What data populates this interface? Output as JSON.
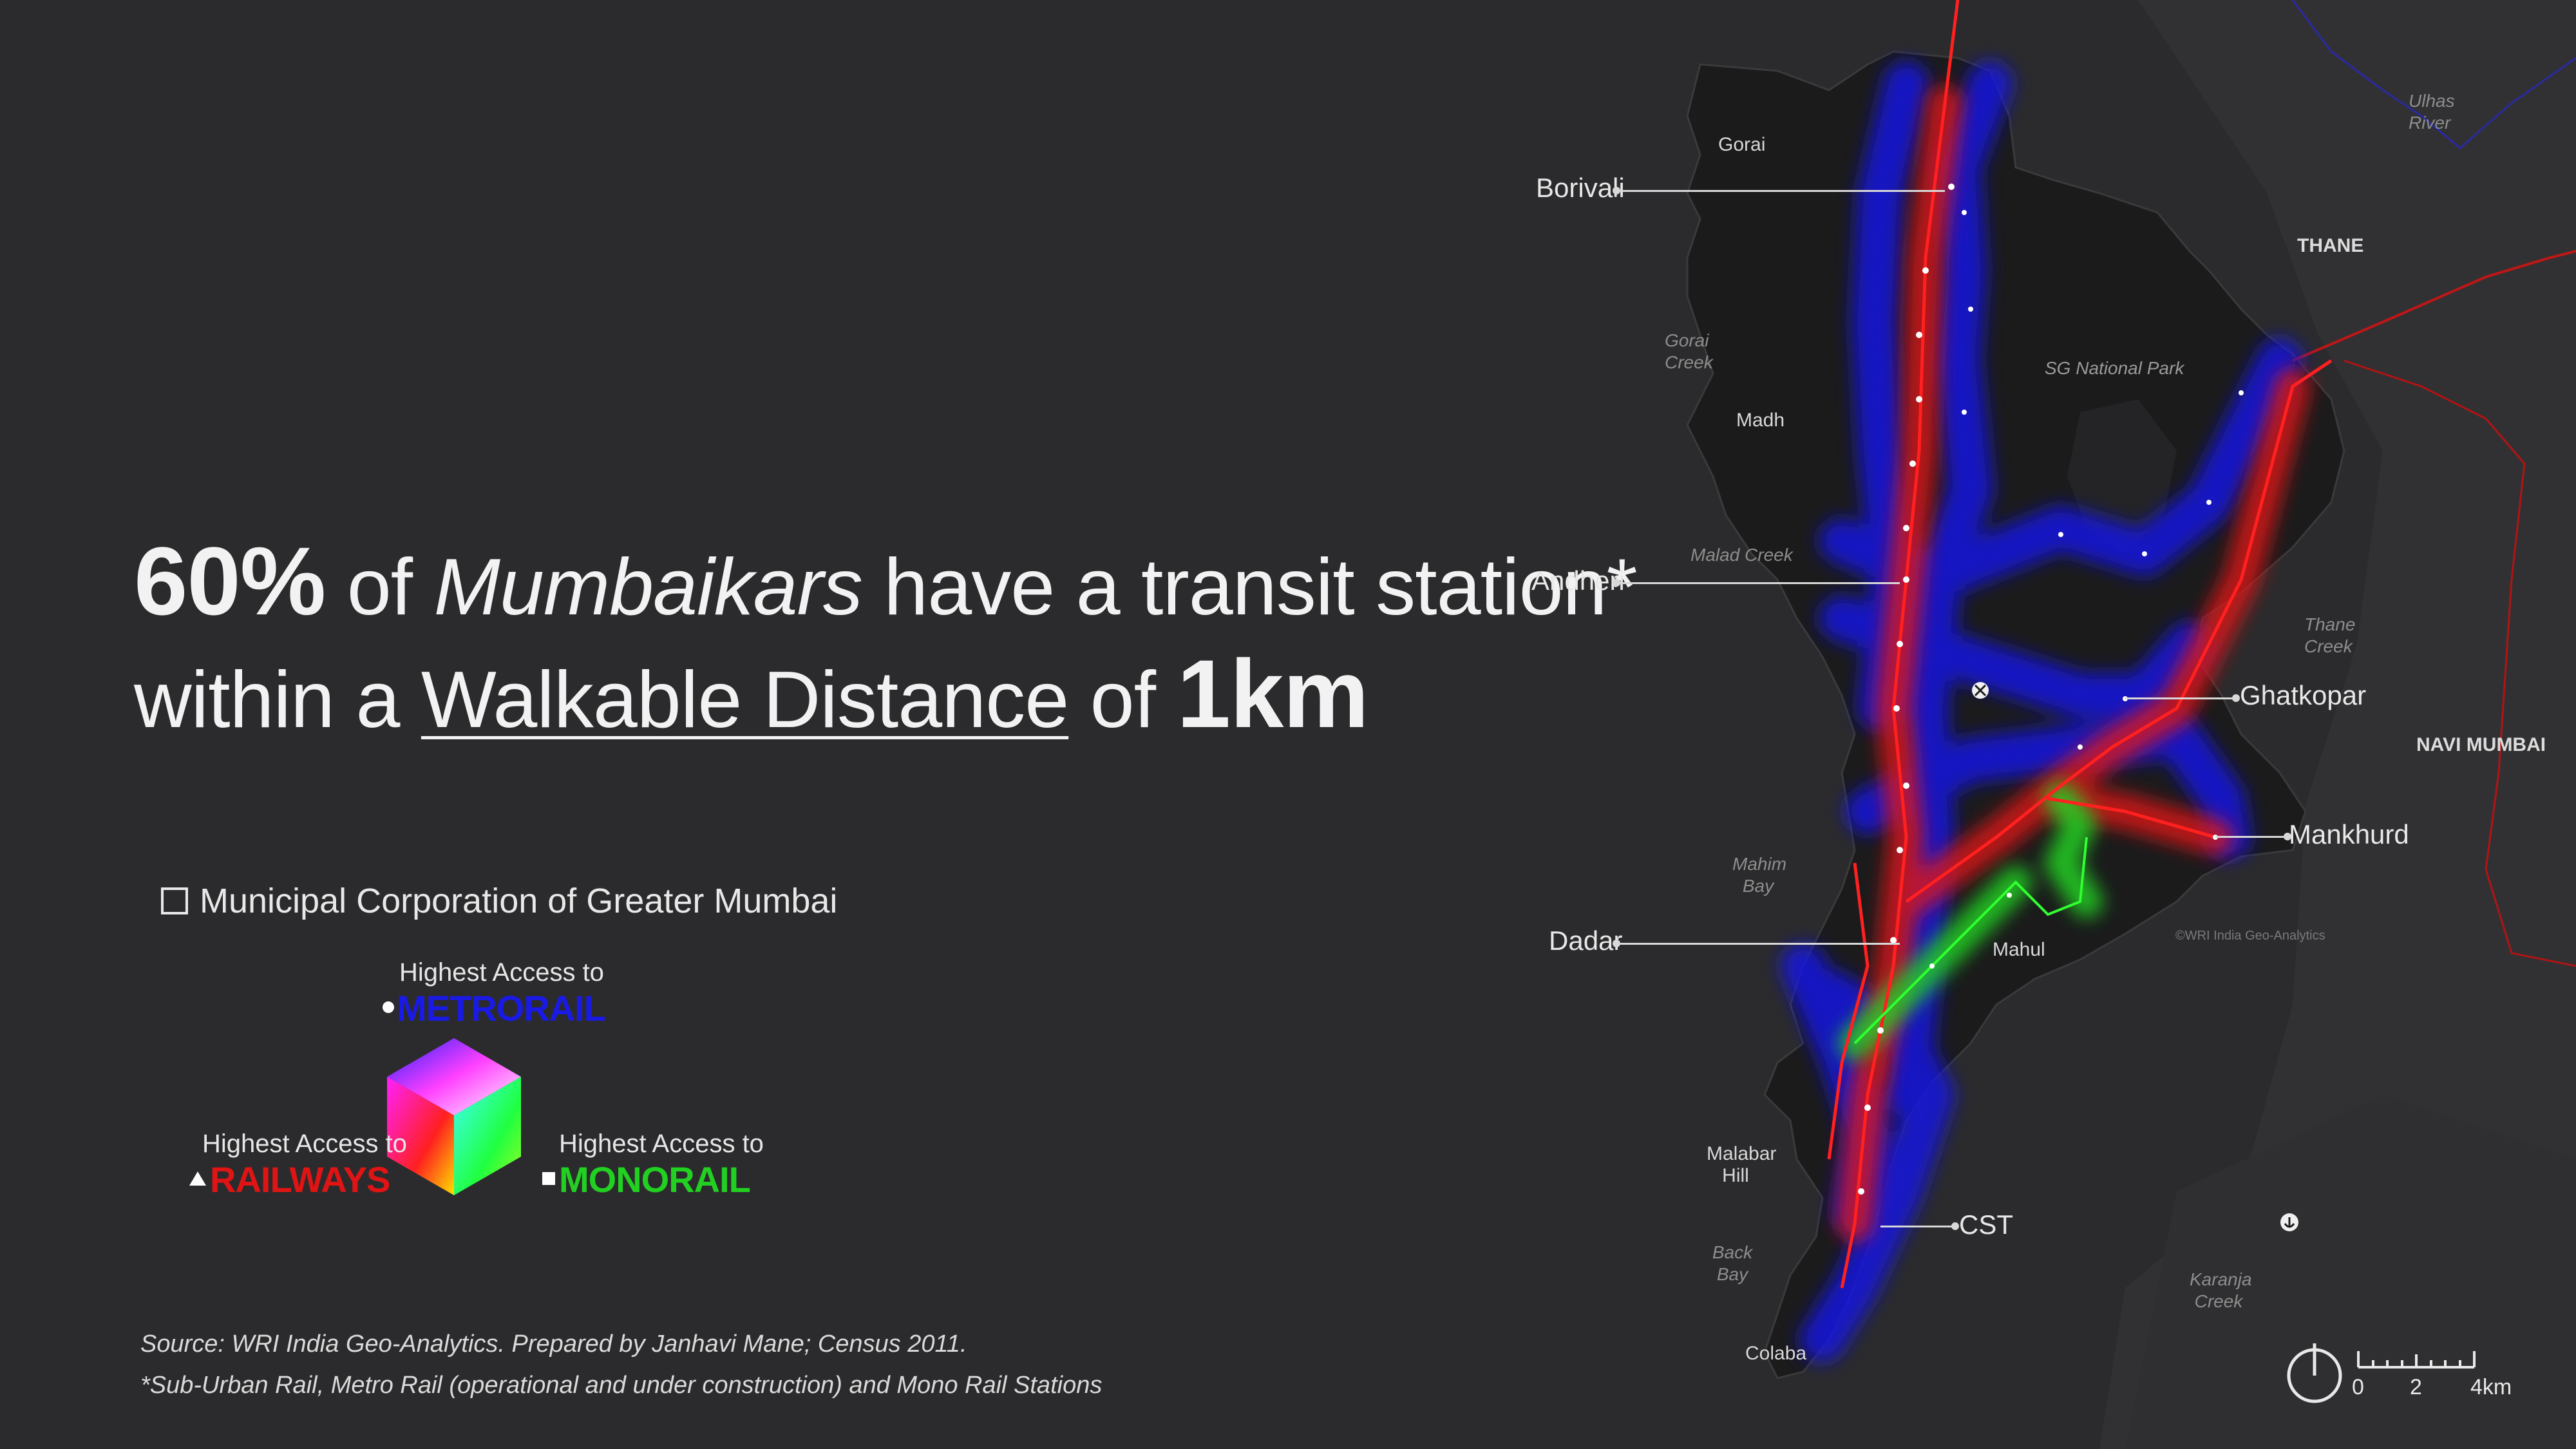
{
  "headline": {
    "line1": {
      "stat": "60%",
      "of": "of",
      "subject": "Mumbaikars",
      "rest": "have a transit station*"
    },
    "line2": {
      "within": "within a",
      "walkable": "Walkable Distance",
      "of": "of",
      "distance": "1km"
    }
  },
  "legend": {
    "boundary_label": "Municipal Corporation of Greater Mumbai",
    "metro": {
      "caption": "Highest Access to",
      "mode": "METRORAIL",
      "color": "#1a1ae6",
      "symbol": "circle"
    },
    "rail": {
      "caption": "Highest Access to",
      "mode": "RAILWAYS",
      "color": "#e01414",
      "symbol": "triangle"
    },
    "mono": {
      "caption": "Highest Access to",
      "mode": "MONORAIL",
      "color": "#22d022",
      "symbol": "square"
    }
  },
  "source": {
    "line1": "Source: WRI India Geo-Analytics. Prepared by Janhavi Mane; Census 2011.",
    "line2": "*Sub-Urban Rail, Metro Rail (operational and under construction) and Mono Rail Stations"
  },
  "map": {
    "station_labels": {
      "borivali": "Borivali",
      "andheri": "Andheri",
      "dadar": "Dadar",
      "ghatkopar": "Ghatkopar",
      "mankhurd": "Mankhurd",
      "cst": "CST"
    },
    "places": {
      "gorai": "Gorai",
      "madh": "Madh",
      "mahul": "Mahul",
      "malabar_hill": "Malabar Hill",
      "colaba": "Colaba",
      "sg_park": "SG National Park"
    },
    "water": {
      "gorai_creek": "Gorai Creek",
      "malad_creek": "Malad Creek",
      "mahim_bay": "Mahim Bay",
      "back_bay": "Back Bay",
      "thane_creek": "Thane Creek",
      "karanja_creek": "Karanja Creek",
      "ulhas_river": "Ulhas River"
    },
    "regions": {
      "thane": "THANE",
      "navi_mumbai": "NAVI MUMBAI"
    },
    "credit": "©WRI India Geo-Analytics",
    "scale": {
      "ticks": [
        "0",
        "2",
        "4km"
      ]
    },
    "colors": {
      "land": "#1a1a1b",
      "background": "#2b2b2d",
      "rail": "#e01414",
      "metro": "#1a1ae6",
      "mono": "#22d022"
    }
  }
}
